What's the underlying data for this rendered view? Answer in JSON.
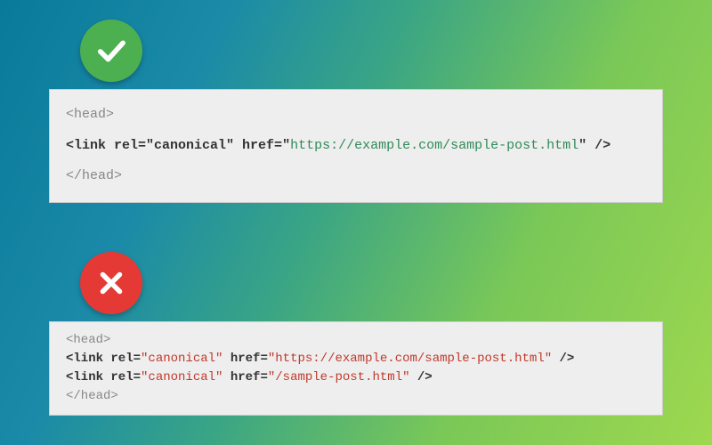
{
  "correct_block": {
    "open_head": "<head>",
    "link_prefix": "<link rel=",
    "rel_val": "\"canonical\"",
    "href_label": " href=",
    "href_q_open": "\"",
    "href_url": "https://example.com/sample-post.html",
    "href_q_close": "\"",
    "link_suffix": " />",
    "close_head": "</head>"
  },
  "incorrect_block": {
    "open_head": "<head>",
    "link1": {
      "link_prefix": "<link rel=",
      "rel_val": "\"canonical\"",
      "href_label": " href=",
      "href_q_open": "\"",
      "href_url": "https://example.com/sample-post.html",
      "href_q_close": "\"",
      "link_suffix": " />"
    },
    "link2": {
      "link_prefix": "<link rel=",
      "rel_val": "\"canonical\"",
      "href_label": " href=",
      "href_q_open": "\"",
      "href_url": "/sample-post.html",
      "href_q_close": "\"",
      "link_suffix": " />"
    },
    "close_head": "</head>"
  },
  "icons": {
    "check": "check-icon",
    "cross": "cross-icon"
  }
}
